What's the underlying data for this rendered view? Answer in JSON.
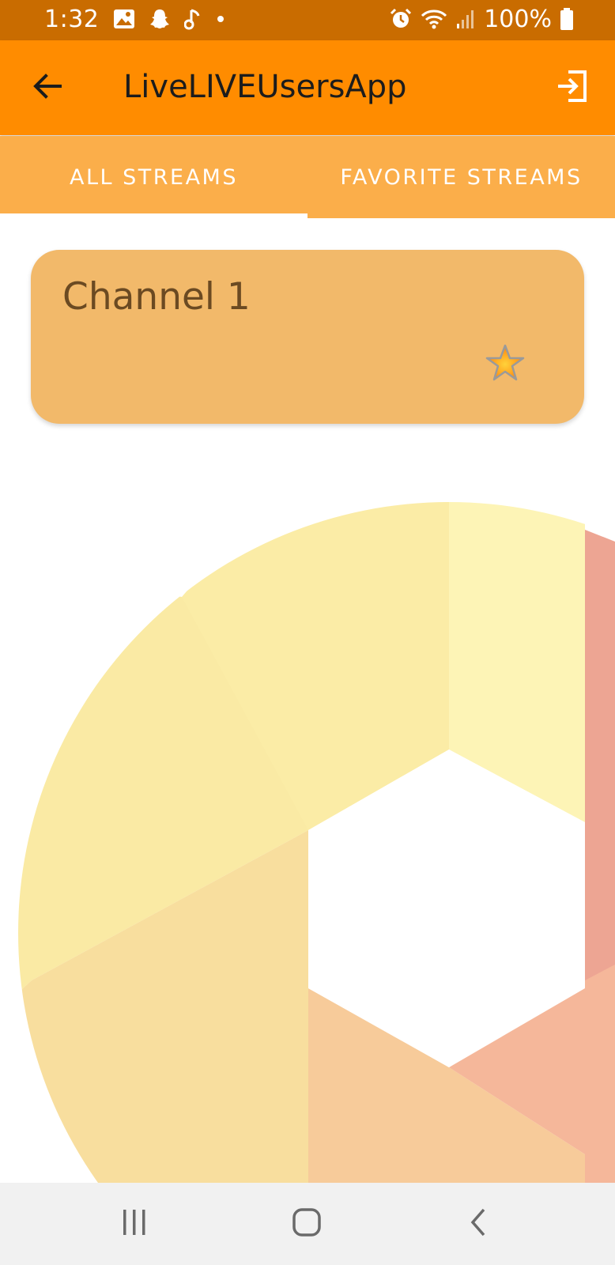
{
  "status_bar": {
    "time": "1:32",
    "battery": "100%",
    "icons": [
      "image-icon",
      "snapchat-icon",
      "music-note-icon",
      "notification-dot-icon",
      "alarm-icon",
      "wifi-icon",
      "signal-icon",
      "battery-icon"
    ]
  },
  "app_bar": {
    "title": "LiveLIVEUsersApp",
    "back_icon": "arrow-left-icon",
    "logout_icon": "exit-icon",
    "background": "#ff8c00"
  },
  "tabs": [
    {
      "label": "ALL STREAMS",
      "selected": true
    },
    {
      "label": "FAVORITE STREAMS",
      "selected": false
    }
  ],
  "channels": [
    {
      "title": "Channel 1",
      "favorite": true,
      "favorite_icon": "star-icon"
    }
  ],
  "nav_bar": {
    "icons": [
      "recent-apps-icon",
      "home-icon",
      "back-icon"
    ]
  },
  "colors": {
    "status_bar": "#c96c00",
    "tab_bar": "#fbae4a",
    "card": "#f2b96a",
    "card_text": "#6b4a22"
  }
}
